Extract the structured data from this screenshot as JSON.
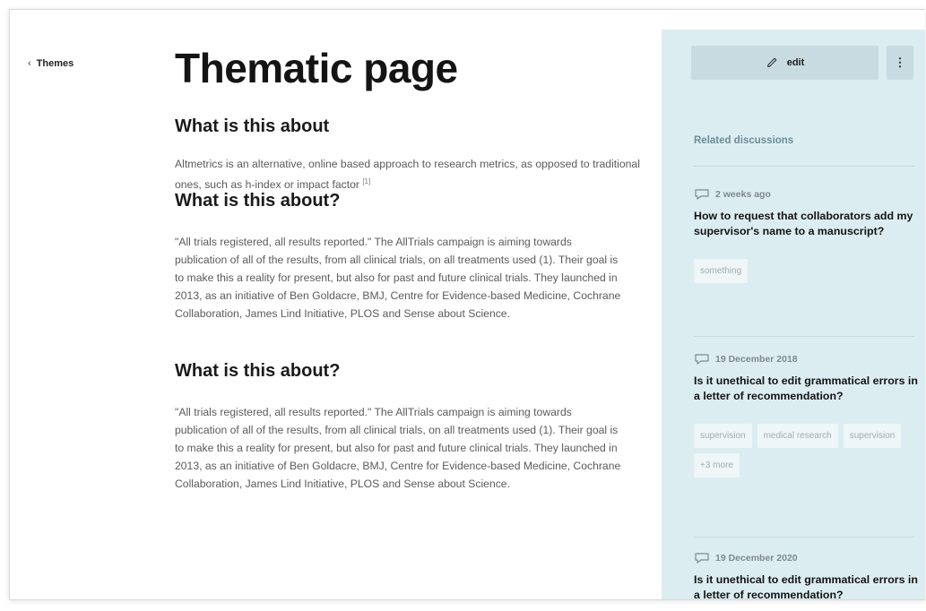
{
  "nav": {
    "back_label": "Themes"
  },
  "main": {
    "title": "Thematic page",
    "sections": [
      {
        "heading": "What is this about",
        "body": "Altmetrics is an alternative, online based approach to research metrics, as opposed to traditional ones, such as h-index or impact factor",
        "footnote": "[1]"
      },
      {
        "heading": "What is this about?",
        "body": "\"All trials registered, all results reported.\" The AllTrials campaign is aiming towards publication of all of the results, from all clinical trials, on all treatments used (1). Their goal is to make this a reality for present, but also for past and future clinical trials. They launched in 2013, as an initiative of Ben Goldacre, BMJ, Centre for Evidence-based Medicine, Cochrane Collaboration, James Lind Initiative, PLOS and Sense about Science."
      },
      {
        "heading": "What is this about?",
        "body": "\"All trials registered, all results reported.\" The AllTrials campaign is aiming towards publication of all of the results, from all clinical trials, on all treatments used (1). Their goal is to make this a reality for present, but also for past and future clinical trials. They launched in 2013, as an initiative of Ben Goldacre, BMJ, Centre for Evidence-based Medicine, Cochrane Collaboration, James Lind Initiative, PLOS and Sense about Science."
      }
    ]
  },
  "sidebar": {
    "edit_label": "edit",
    "more_label": "⋮",
    "heading": "Related discussions",
    "discussions": [
      {
        "date": "2 weeks ago",
        "title": "How to request that collaborators add my supervisor's name to a manuscript?",
        "tags": [
          "something"
        ]
      },
      {
        "date": "19 December 2018",
        "title": "Is it unethical to edit grammatical errors in a letter of recommendation?",
        "tags": [
          "supervision",
          "medical research",
          "supervision",
          "+3 more"
        ]
      },
      {
        "date": "19 December 2020",
        "title": "Is it unethical to edit grammatical errors in a letter of recommendation?",
        "tags": []
      }
    ]
  },
  "colors": {
    "sidebar_bg": "#dcedf1",
    "button_bg": "#c8dbe0",
    "sidebar_heading": "#6c8d96",
    "body_text": "#5b5b5b",
    "tag_bg": "#eef6f8"
  },
  "icons": {
    "back": "chevron-left-icon",
    "edit": "pencil-icon",
    "more": "kebab-menu-icon",
    "discussion": "speech-bubble-icon"
  }
}
